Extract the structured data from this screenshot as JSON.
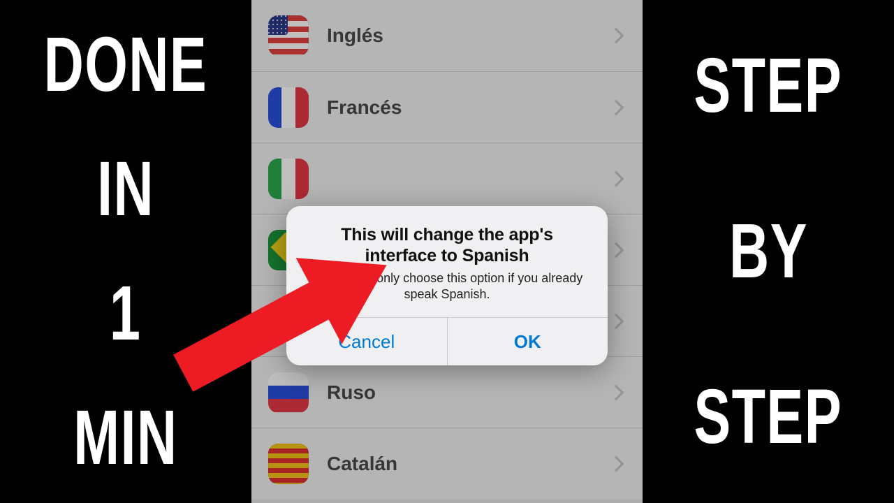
{
  "left_text": {
    "w1": "DONE",
    "w2": "IN",
    "w3": "1",
    "w4": "MIN"
  },
  "right_text": {
    "w1": "STEP",
    "w2": "BY",
    "w3": "STEP"
  },
  "languages": {
    "items": [
      {
        "label": "Inglés",
        "flag_name": "usa-flag-icon"
      },
      {
        "label": "Francés",
        "flag_name": "france-flag-icon"
      },
      {
        "label": "",
        "flag_name": "italy-flag-icon"
      },
      {
        "label": "",
        "flag_name": "brazil-flag-icon"
      },
      {
        "label": "",
        "flag_name": "germany-flag-icon"
      },
      {
        "label": "Ruso",
        "flag_name": "russia-flag-icon"
      },
      {
        "label": "Catalán",
        "flag_name": "catalonia-flag-icon"
      }
    ]
  },
  "modal": {
    "title": "This will change the app's interface to Spanish",
    "message": "You should only choose this option if you already speak Spanish.",
    "cancel": "Cancel",
    "ok": "OK"
  }
}
